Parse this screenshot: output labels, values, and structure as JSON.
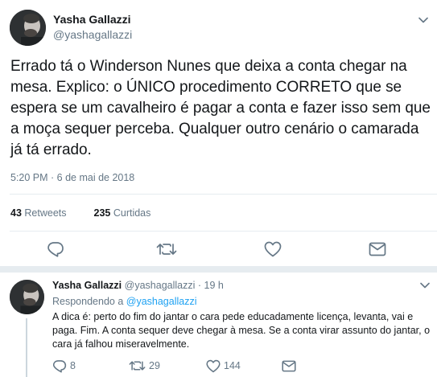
{
  "main_tweet": {
    "display_name": "Yasha Gallazzi",
    "handle": "@yashagallazzi",
    "text": "Errado tá o Winderson Nunes que deixa a conta chegar na mesa. Explico: o ÚNICO procedimento CORRETO que se espera se um cavalheiro é pagar a conta e fazer isso sem que a moça sequer perceba. Qualquer outro cenário o camarada já tá errado.",
    "timestamp": "5:20 PM · 6 de mai de 2018",
    "stats": {
      "retweets_count": "43",
      "retweets_label": "Retweets",
      "likes_count": "235",
      "likes_label": "Curtidas"
    },
    "actions": {
      "reply_icon": "reply-icon",
      "retweet_icon": "retweet-icon",
      "like_icon": "heart-icon",
      "dm_icon": "envelope-icon"
    }
  },
  "reply_tweet": {
    "display_name": "Yasha Gallazzi",
    "handle": "@yashagallazzi",
    "separator": "·",
    "time": "19 h",
    "replying_prefix": "Respondendo a",
    "replying_to": "@yashagallazzi",
    "text": "A dica é: perto do fim do jantar o cara pede educadamente licença, levanta, vai e paga. Fim. A conta sequer deve chegar à mesa. Se a conta virar assunto do jantar, o cara já falhou miseravelmente.",
    "counts": {
      "replies": "8",
      "retweets": "29",
      "likes": "144"
    }
  },
  "colors": {
    "text_primary": "#14171a",
    "text_secondary": "#657786",
    "link": "#1da1f2",
    "divider": "#e6ecf0"
  }
}
